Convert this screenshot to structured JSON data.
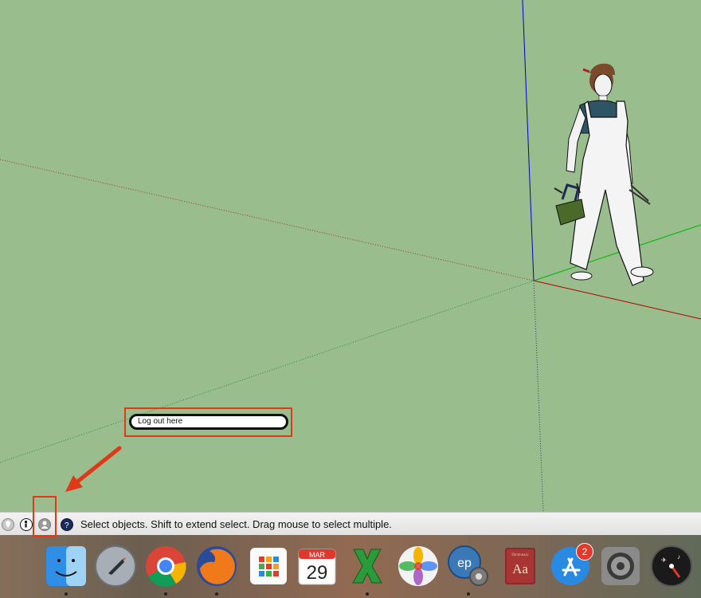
{
  "tooltip": {
    "text": "Log out here"
  },
  "status": {
    "message": "Select objects. Shift to extend select. Drag mouse to select multiple."
  },
  "dock": {
    "calendar": {
      "month": "MAR",
      "day": "29"
    },
    "app_store_badge": "2",
    "dictionary_label": "Dictionary",
    "dictionary_glyph": "Aa"
  },
  "icons": [
    "geo-location-icon",
    "credits-icon",
    "user-account-icon",
    "help-icon"
  ],
  "colors": {
    "canvas": "#99bd8d",
    "highlight": "#e0391a",
    "axis_red": "#b40000",
    "axis_green": "#00b400",
    "axis_blue": "#0000c8"
  }
}
